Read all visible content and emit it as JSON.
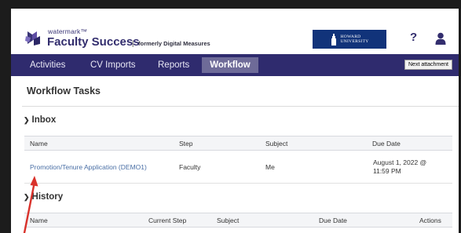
{
  "header": {
    "brand_small": "watermark™",
    "brand_title": "Faculty Success",
    "separator": "|",
    "formerly": "formerly Digital Measures",
    "university_line1": "HOWARD",
    "university_line2": "UNIVERSITY",
    "help_symbol": "?"
  },
  "nav": {
    "items": [
      "Activities",
      "CV Imports",
      "Reports",
      "Workflow"
    ],
    "active": "Workflow",
    "tooltip": "Next attachment"
  },
  "main": {
    "title": "Workflow Tasks",
    "inbox": {
      "heading": "Inbox",
      "columns": [
        "Name",
        "Step",
        "Subject",
        "Due Date"
      ],
      "rows": [
        {
          "name": "Promotion/Tenure Application (DEMO1)",
          "step": "Faculty",
          "subject": "Me",
          "due_line1": "August 1, 2022 @",
          "due_line2": "11:59 PM"
        }
      ]
    },
    "history": {
      "heading": "History",
      "columns": [
        "Name",
        "Current Step",
        "Subject",
        "Due Date",
        "Actions"
      ]
    }
  },
  "colors": {
    "nav_bg": "#2f2b6e",
    "nav_active": "#6e6b98",
    "brand": "#332e6e",
    "link": "#4a6fa5",
    "university": "#11337a",
    "annotation": "#d9322b"
  },
  "icons": {
    "logo": "watermark-logo-icon",
    "help": "question-icon",
    "user": "user-icon",
    "university": "university-tower-icon",
    "collapse": "chevron-down-icon"
  }
}
